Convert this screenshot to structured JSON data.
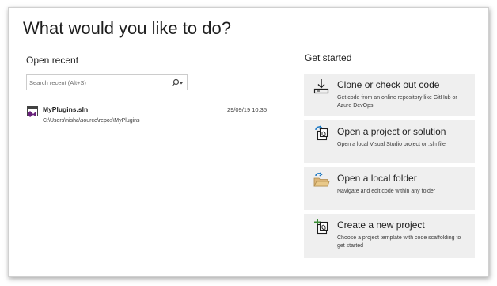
{
  "page": {
    "title": "What would you like to do?"
  },
  "open_recent": {
    "heading": "Open recent",
    "search_placeholder": "Search recent (Alt+S)",
    "items": [
      {
        "name": "MyPlugins.sln",
        "path": "C:\\Users\\nisha\\source\\repos\\MyPlugins",
        "date": "29/09/19 10:35",
        "icon": "solution-file-icon"
      }
    ]
  },
  "get_started": {
    "heading": "Get started",
    "cards": [
      {
        "title": "Clone or check out code",
        "description": "Get code from an online repository like GitHub or Azure DevOps",
        "icon": "clone-download-icon"
      },
      {
        "title": "Open a project or solution",
        "description": "Open a local Visual Studio project or .sln file",
        "icon": "open-project-icon"
      },
      {
        "title": "Open a local folder",
        "description": "Navigate and edit code within any folder",
        "icon": "open-folder-icon"
      },
      {
        "title": "Create a new project",
        "description": "Choose a project template with code scaffolding to get started",
        "icon": "new-project-icon"
      }
    ]
  },
  "colors": {
    "card_background": "#efefef",
    "accent_blue": "#0e70c0",
    "vs_purple": "#68217a",
    "folder_yellow": "#dcb67a",
    "add_green": "#388a34"
  }
}
